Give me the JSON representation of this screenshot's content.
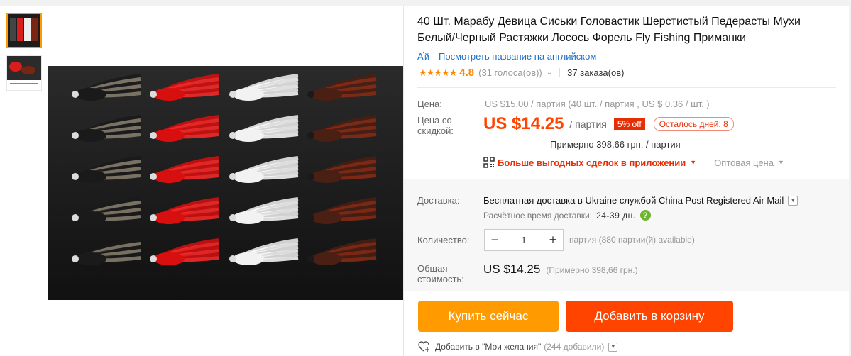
{
  "title": "40 Шт. Марабу Девица Сиськи Головастик Шерстистый Педерасты Мухи Белый/Черный Растяжки Лосось Форель Fly Fishing Приманки",
  "translate_link": "Посмотреть название на английском",
  "rating": {
    "stars": "★★★★★",
    "value": "4.8",
    "votes": "(31 голоса(ов))",
    "orders": "37 заказа(ов)"
  },
  "price": {
    "label": "Цена:",
    "original": "US $15.00 / партия",
    "original_detail": "(40 шт. / партия , US $ 0.36 / шт. )",
    "discount_label_1": "Цена со",
    "discount_label_2": "скидкой:",
    "current": "US $14.25",
    "unit": "/ партия",
    "discount_badge": "5% off",
    "days_left": "Осталось дней: 8",
    "approx_uah": "Примерно 398,66 грн. / партия"
  },
  "app_promo": {
    "label": "Больше выгодных сделок в приложении",
    "wholesale": "Оптовая цена"
  },
  "shipping": {
    "label": "Доставка:",
    "text": "Бесплатная доставка в Ukraine службой China Post Registered Air Mail",
    "eta_label": "Расчётное время доставки:",
    "eta_days": "24-39 дн."
  },
  "quantity": {
    "label": "Количество:",
    "value": "1",
    "note": "партия (880 партии(й) available)",
    "minus": "−",
    "plus": "+"
  },
  "total": {
    "label_1": "Общая",
    "label_2": "стоимость:",
    "value": "US $14.25",
    "approx": "(Примерно 398,66 грн.)"
  },
  "buttons": {
    "buy_now": "Купить сейчас",
    "add_to_cart": "Добавить в корзину"
  },
  "wishlist": {
    "label": "Добавить в \"Мои желания\"",
    "count": "(244 добавили)"
  },
  "colors": {
    "accent_orange": "#ff9a00",
    "accent_red": "#ff4400",
    "link_blue": "#1a6fc9",
    "star": "#ff8a00"
  }
}
